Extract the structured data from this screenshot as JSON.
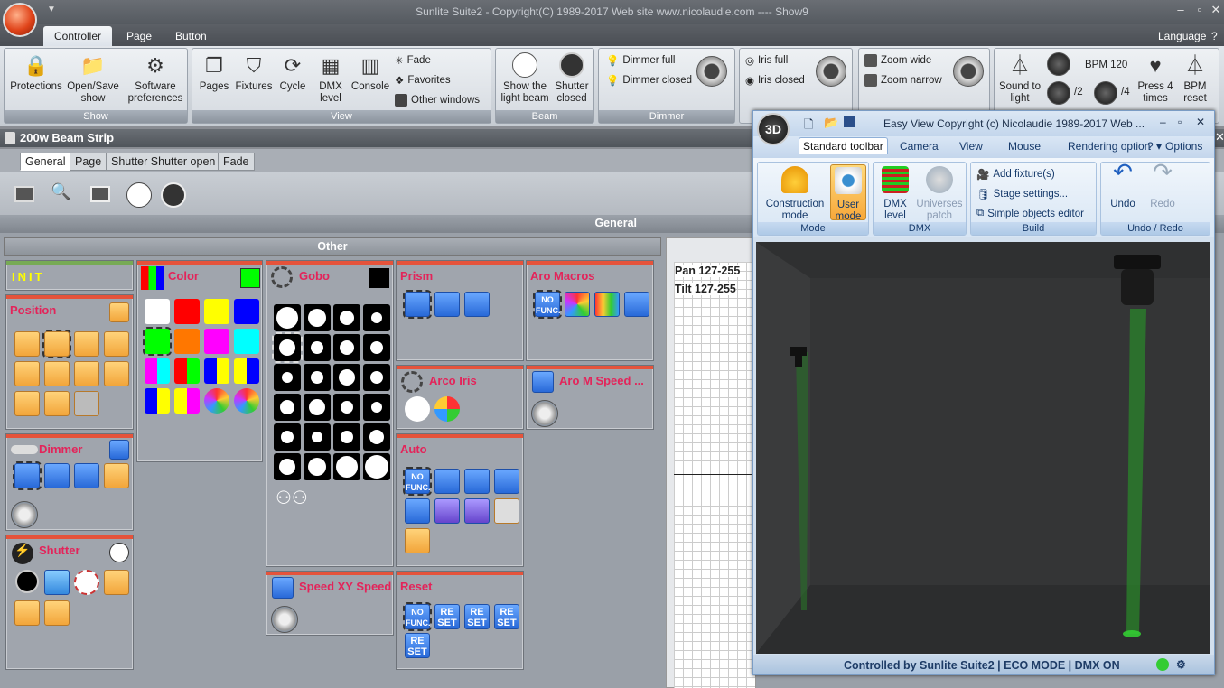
{
  "app": {
    "title": "Sunlite Suite2 - Copyright(C) 1989-2017    Web site www.nicolaudie.com ---- Show9",
    "language": "Language",
    "help": "?"
  },
  "ribbon_tabs": [
    "Controller",
    "Page",
    "Button"
  ],
  "ribbon": {
    "show": {
      "label": "Show",
      "protections": "Protections",
      "open_save": "Open/Save show",
      "software_prefs": "Software preferences"
    },
    "view": {
      "label": "View",
      "pages": "Pages",
      "fixtures": "Fixtures",
      "cycle": "Cycle",
      "dmx_level": "DMX level",
      "console": "Console",
      "fade": "Fade",
      "favorites": "Favorites",
      "other_windows": "Other windows"
    },
    "beam": {
      "label": "Beam",
      "show_light_beam": "Show the light beam",
      "shutter_closed": "Shutter closed"
    },
    "dimmer": {
      "label": "Dimmer",
      "dimmer_full": "Dimmer full",
      "dimmer_closed": "Dimmer closed"
    },
    "iris": {
      "iris_full": "Iris full",
      "iris_closed": "Iris closed"
    },
    "zoom": {
      "zoom_wide": "Zoom wide",
      "zoom_narrow": "Zoom narrow"
    },
    "tempo": {
      "sound_to_light": "Sound to light",
      "bpm": "BPM 120",
      "div2": "/2",
      "div4": "/4",
      "press4": "Press 4 times",
      "bpm_reset": "BPM reset"
    }
  },
  "fixture_title": "200w Beam Strip",
  "sub_tabs": [
    "General",
    "Page",
    "Shutter Shutter open",
    "Fade"
  ],
  "general_label": "General",
  "other_label": "Other",
  "panels": {
    "init": "INIT",
    "position": "Position",
    "dimmer": "Dimmer",
    "shutter": "Shutter",
    "color": "Color",
    "gobo": "Gobo",
    "prism": "Prism",
    "arco_iris": "Arco Iris",
    "auto": "Auto",
    "speed_xy": "Speed XY Speed",
    "aro_macros": "Aro Macros",
    "aro_m_speed": "Aro M Speed ...",
    "reset": "Reset"
  },
  "reset_label": "RE SET",
  "no_func": "NO FUNC.",
  "grid_text": {
    "pan": "Pan 127-255",
    "tilt": "Tilt 127-255"
  },
  "colors": [
    "#ffffff",
    "#ff0000",
    "#ffff00",
    "#0000ff",
    "#00ff00",
    "#ff7700",
    "#ff00ff",
    "#00ffff"
  ],
  "win3d": {
    "title": "Easy View   Copyright (c) Nicolaudie 1989-2017   Web ...",
    "tabs": [
      "Standard toolbar",
      "Camera",
      "View",
      "Mouse",
      "Rendering option"
    ],
    "options": "Options",
    "construction_mode": "Construction mode",
    "user_mode": "User mode",
    "mode_group": "Mode",
    "dmx_level": "DMX level",
    "universes_patch": "Universes patch",
    "dmx_group": "DMX",
    "add_fixtures": "Add fixture(s)",
    "stage_settings": "Stage settings...",
    "simple_objects": "Simple objects editor",
    "build_group": "Build",
    "undo": "Undo",
    "redo": "Redo",
    "undo_group": "Undo / Redo",
    "status": "Controlled by Sunlite Suite2   |   ECO MODE   |   DMX ON"
  }
}
